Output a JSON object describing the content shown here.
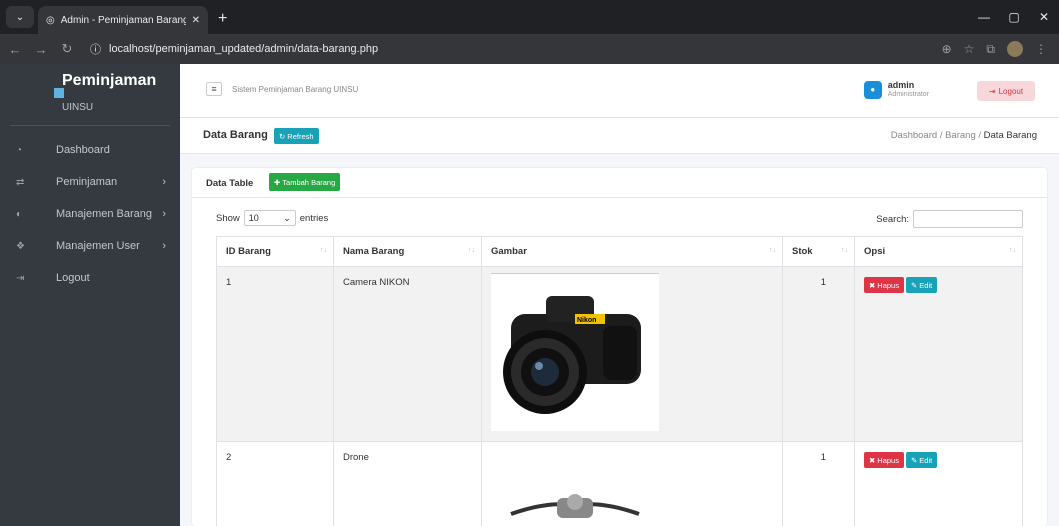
{
  "browser": {
    "tab_title": "Admin - Peminjaman Barang U",
    "url": "localhost/peminjaman_updated/admin/data-barang.php"
  },
  "sidebar": {
    "brand": "Peminjaman",
    "brand_sub": "UINSU",
    "items": [
      {
        "label": "Dashboard",
        "icon": "dashboard-icon",
        "has_children": false
      },
      {
        "label": "Peminjaman",
        "icon": "exchange-icon",
        "has_children": true
      },
      {
        "label": "Manajemen Barang",
        "icon": "box-icon",
        "has_children": true
      },
      {
        "label": "Manajemen User",
        "icon": "users-icon",
        "has_children": true
      },
      {
        "label": "Logout",
        "icon": "sign-out-icon",
        "has_children": false
      }
    ]
  },
  "header": {
    "app_name": "Sistem Peminjaman Barang UINSU",
    "user_name": "admin",
    "user_role": "Administrator",
    "logout_label": "Logout"
  },
  "page": {
    "title": "Data Barang",
    "refresh_label": "Refresh",
    "breadcrumb": [
      "Dashboard",
      "Barang",
      "Data Barang"
    ]
  },
  "card": {
    "title": "Data Table",
    "add_label": "Tambah Barang",
    "show_label": "Show",
    "entries_value": "10",
    "entries_label": "entries",
    "search_label": "Search:"
  },
  "table": {
    "columns": [
      "ID Barang",
      "Nama Barang",
      "Gambar",
      "Stok",
      "Opsi"
    ],
    "rows": [
      {
        "id": "1",
        "name": "Camera NIKON",
        "image": "camera-nikon-photo",
        "stock": "1"
      },
      {
        "id": "2",
        "name": "Drone",
        "image": "drone-photo",
        "stock": "1"
      }
    ],
    "delete_label": "Hapus",
    "edit_label": "Edit"
  },
  "colors": {
    "sidebar_bg": "#343a40",
    "info": "#17a2b8",
    "success": "#28a745",
    "danger": "#dc3545"
  }
}
